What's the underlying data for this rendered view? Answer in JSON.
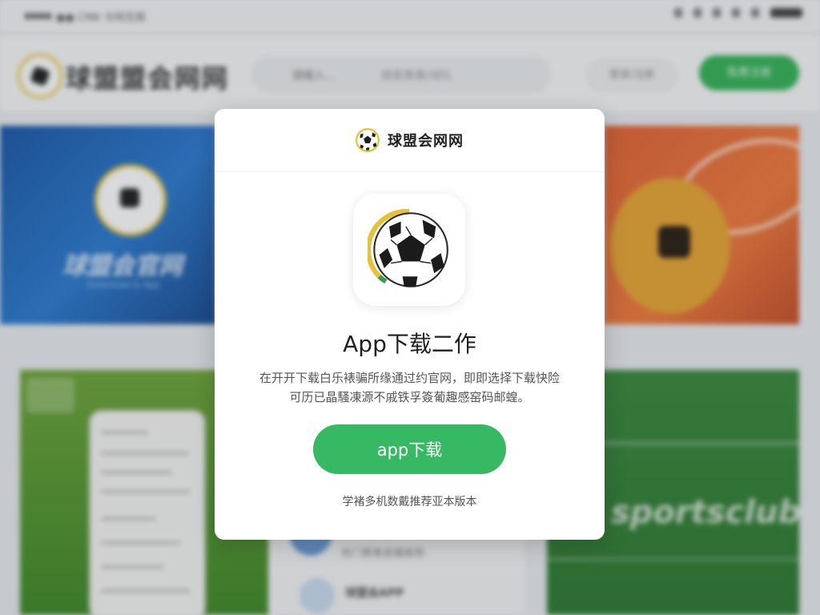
{
  "status_bar": {
    "signal": "●●●●",
    "carrier": "●● CMK 令网无限",
    "icons": [
      "alarm-icon",
      "location-icon",
      "bluetooth-icon",
      "headphones-icon",
      "wifi-icon",
      "battery-icon"
    ]
  },
  "header": {
    "site_name": "球盟盟会网网",
    "search_text": "请输入...",
    "search_placeholder": "搜索赛事/球队",
    "login_label": "登录/注册",
    "signup_label": "免费注册"
  },
  "background": {
    "banner_left_title": "球盟会官网",
    "banner_left_sub": "Download & App",
    "card_mid_item1": "热门赛事直播推荐",
    "card_mid_item2": "球盟会APP",
    "card_right_text": "sportsclub"
  },
  "modal": {
    "brand_name": "球盟会网网",
    "title": "App下载二作",
    "desc_line1": "在开开下载白乐裱骗所缘通过约官网，即即选择下载快险",
    "desc_line2": "可历已晶騷凍源不戚铁孚簽葡趣感窑码邮蝗。",
    "download_label": "app下载",
    "note": "学褚多机数戴推荐亚本版本"
  },
  "colors": {
    "accent_green": "#36b962",
    "ball_ring_yellow": "#e6c23a",
    "text_dark": "#1f1f1f"
  }
}
